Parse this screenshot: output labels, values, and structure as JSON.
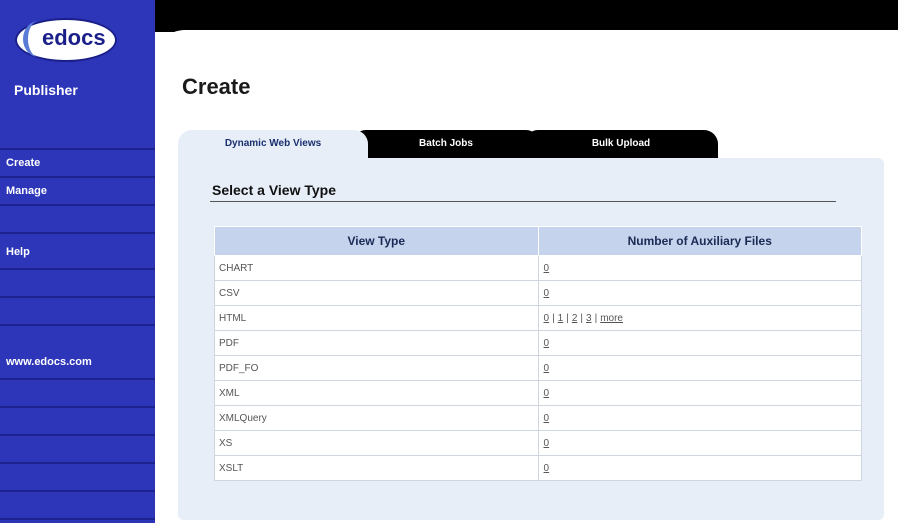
{
  "app": {
    "logo_text": "edocs",
    "name": "Publisher"
  },
  "sidebar": {
    "items": [
      {
        "label": ""
      },
      {
        "label": "Create"
      },
      {
        "label": "Manage"
      },
      {
        "label": ""
      },
      {
        "label": "Help"
      },
      {
        "label": ""
      },
      {
        "label": ""
      },
      {
        "label": ""
      },
      {
        "label": "www.edocs.com"
      },
      {
        "label": ""
      },
      {
        "label": ""
      },
      {
        "label": ""
      },
      {
        "label": ""
      },
      {
        "label": ""
      }
    ]
  },
  "page": {
    "title": "Create"
  },
  "tabs": [
    {
      "label": "Dynamic Web Views"
    },
    {
      "label": "Batch Jobs"
    },
    {
      "label": "Bulk Upload"
    }
  ],
  "section": {
    "title": "Select a View Type"
  },
  "table": {
    "headers": [
      "View Type",
      "Number of Auxiliary Files"
    ],
    "rows": [
      {
        "view_type": "CHART",
        "files": [
          "0"
        ]
      },
      {
        "view_type": "CSV",
        "files": [
          "0"
        ]
      },
      {
        "view_type": "HTML",
        "files": [
          "0",
          "1",
          "2",
          "3",
          "more"
        ]
      },
      {
        "view_type": "PDF",
        "files": [
          "0"
        ]
      },
      {
        "view_type": "PDF_FO",
        "files": [
          "0"
        ]
      },
      {
        "view_type": "XML",
        "files": [
          "0"
        ]
      },
      {
        "view_type": "XMLQuery",
        "files": [
          "0"
        ]
      },
      {
        "view_type": "XS",
        "files": [
          "0"
        ]
      },
      {
        "view_type": "XSLT",
        "files": [
          "0"
        ]
      }
    ]
  },
  "colors": {
    "sidebar": "#2d36b8",
    "panel": "#e7eef7",
    "header_row": "#c5d4ec",
    "tab_inactive": "#000000"
  }
}
